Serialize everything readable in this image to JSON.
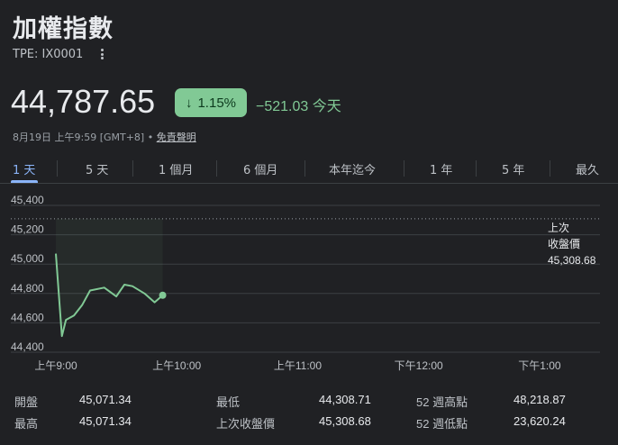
{
  "header": {
    "title": "加權指數",
    "ticker": "TPE: IX0001"
  },
  "quote": {
    "price": "44,787.65",
    "change_percent": "1.15%",
    "change_direction": "down",
    "change_value": "−521.03 今天",
    "timestamp": "8月19日 上午9:59 [GMT+8] • ",
    "disclaimer": "免責聲明"
  },
  "tabs": [
    {
      "label": "1 天",
      "active": true
    },
    {
      "label": "5 天",
      "active": false
    },
    {
      "label": "1 個月",
      "active": false
    },
    {
      "label": "6 個月",
      "active": false
    },
    {
      "label": "本年迄今",
      "active": false
    },
    {
      "label": "1 年",
      "active": false
    },
    {
      "label": "5 年",
      "active": false
    },
    {
      "label": "最久",
      "active": false
    }
  ],
  "prev_close": {
    "label_line1": "上次",
    "label_line2": "收盤價",
    "value": "45,308.68"
  },
  "colors": {
    "positive_accent": "#81c995",
    "active_tab": "#8ab4f8",
    "background": "#202124"
  },
  "chart_data": {
    "type": "line",
    "y_ticks": [
      "45,400",
      "45,200",
      "45,000",
      "44,800",
      "44,600",
      "44,400"
    ],
    "ylim": [
      44400,
      45400
    ],
    "x_ticks": [
      "上午9:00",
      "上午10:00",
      "上午11:00",
      "下午12:00",
      "下午1:00"
    ],
    "x_tick_minutes": [
      540,
      600,
      660,
      720,
      780
    ],
    "xlim_minutes": [
      540,
      810
    ],
    "reference_line": 45308.68,
    "series": [
      {
        "x_minutes": [
          540,
          543,
          545,
          549,
          553,
          557,
          564,
          570,
          574,
          578,
          584,
          589,
          593
        ],
        "values": [
          45071,
          44510,
          44620,
          44650,
          44720,
          44820,
          44840,
          44780,
          44860,
          44850,
          44800,
          44740,
          44788
        ]
      }
    ]
  },
  "stats": [
    {
      "label": "開盤",
      "value": "45,071.34"
    },
    {
      "label": "最高",
      "value": "45,071.34"
    },
    {
      "label": "最低",
      "value": "44,308.71"
    },
    {
      "label": "上次收盤價",
      "value": "45,308.68"
    },
    {
      "label": "52 週高點",
      "value": "48,218.87"
    },
    {
      "label": "52 週低點",
      "value": "23,620.24"
    }
  ]
}
